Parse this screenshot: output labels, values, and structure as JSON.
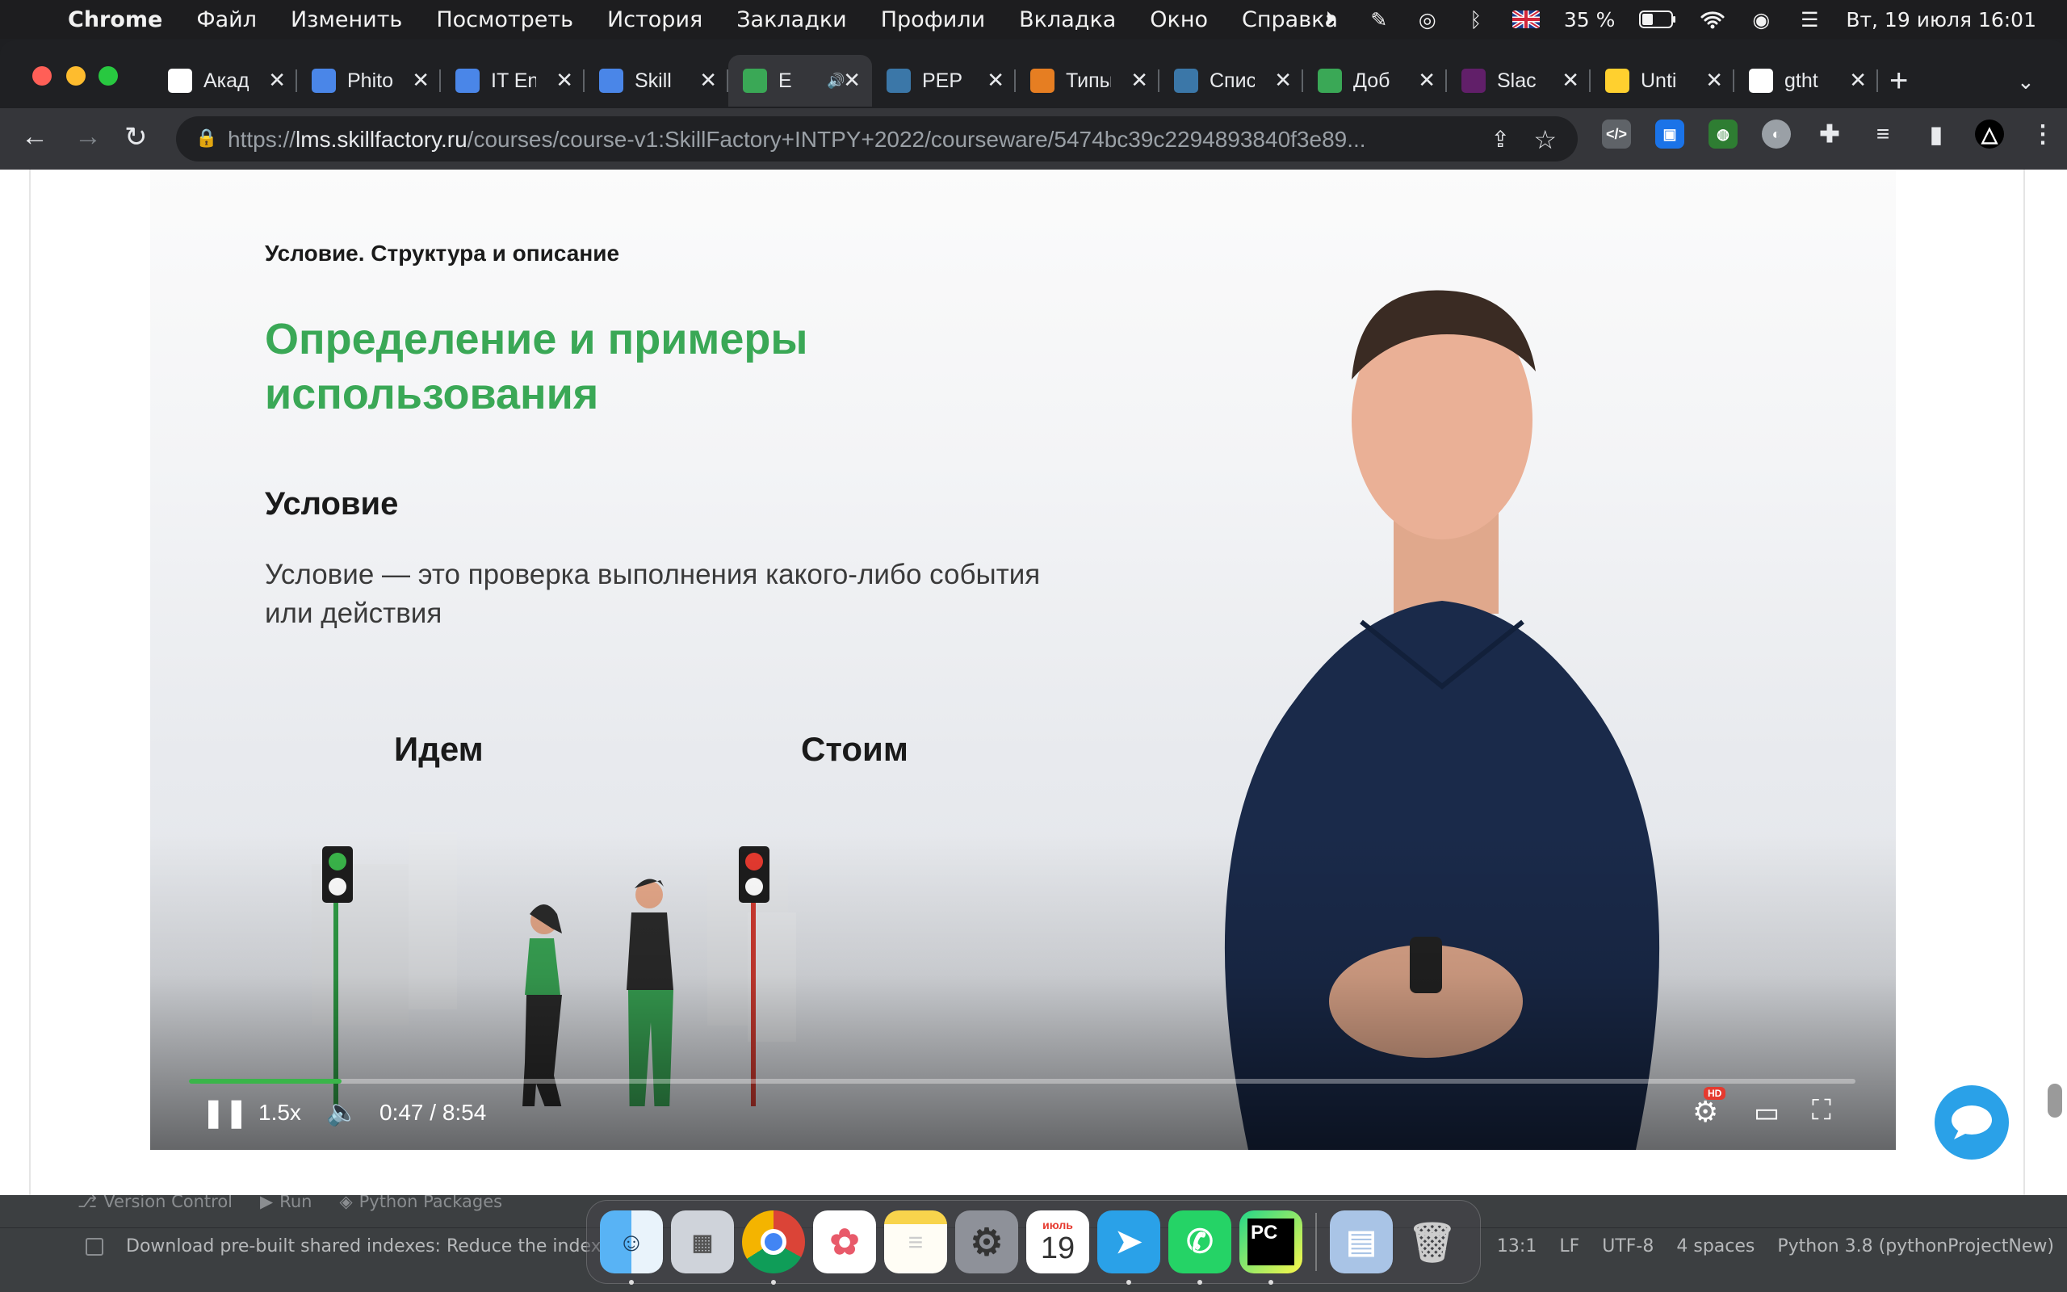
{
  "menubar": {
    "app": "Chrome",
    "items": [
      "Файл",
      "Изменить",
      "Посмотреть",
      "История",
      "Закладки",
      "Профили",
      "Вкладка",
      "Окно",
      "Справка"
    ],
    "battery": "35 %",
    "datetime": "Вт, 19 июля  16:01"
  },
  "tabs": [
    {
      "title": "Акад",
      "fav": "academy-favicon",
      "color": "#ffffff"
    },
    {
      "title": "Phito",
      "fav": "docs-favicon",
      "color": "#4a86e8"
    },
    {
      "title": "IT En",
      "fav": "docs-favicon",
      "color": "#4a86e8"
    },
    {
      "title": "Skill",
      "fav": "docs-favicon",
      "color": "#4a86e8"
    },
    {
      "title": "E",
      "fav": "skillfactory-favicon",
      "color": "#3aa856",
      "active": true
    },
    {
      "title": "PEP",
      "fav": "python-favicon",
      "color": "#3b77a8"
    },
    {
      "title": "Типы",
      "fav": "codewars-favicon",
      "color": "#e67e22"
    },
    {
      "title": "Спис",
      "fav": "python-favicon",
      "color": "#3b77a8"
    },
    {
      "title": "Доб",
      "fav": "skillfactory-favicon",
      "color": "#3aa856"
    },
    {
      "title": "Slac",
      "fav": "slack-favicon",
      "color": "#611f69"
    },
    {
      "title": "Unti",
      "fav": "miro-favicon",
      "color": "#ffd02f"
    },
    {
      "title": "gtht",
      "fav": "google-favicon",
      "color": "#ffffff"
    }
  ],
  "address": {
    "scheme": "https://",
    "host": "lms.skillfactory.ru",
    "path": "/courses/course-v1:SkillFactory+INTPY+2022/courseware/5474bc39c2294893840f3e89..."
  },
  "slide": {
    "label": "Условие. Структура и описание",
    "title": "Определение и примеры использования",
    "subtitle": "Условие",
    "body": "Условие — это проверка выполнения какого-либо события или действия",
    "go": "Идем",
    "stop": "Стоим"
  },
  "player": {
    "speed": "1.5x",
    "time": "0:47 / 8:54",
    "progress": 0.0917,
    "hd_badge": "HD"
  },
  "pycharm": {
    "tools": [
      "Version Control",
      "Run",
      "Python Packages"
    ],
    "message": "Download pre-built shared indexes: Reduce the indexing",
    "status": [
      "13:1",
      "LF",
      "UTF-8",
      "4 spaces",
      "Python 3.8 (pythonProjectNew)"
    ]
  },
  "dock": {
    "calendar_month": "июль",
    "calendar_day": "19",
    "pycharm_label": "PC"
  },
  "colors": {
    "accent_green": "#3aa856",
    "progress_green": "#3ab54a",
    "chat_blue": "#2aa1e8"
  }
}
